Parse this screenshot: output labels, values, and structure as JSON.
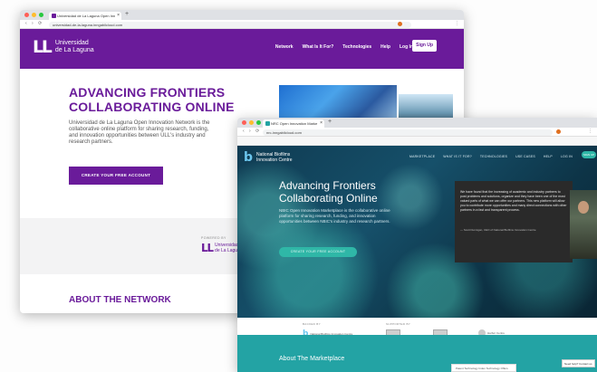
{
  "back_window": {
    "tab_title": "Universidad de La Laguna Open Inn",
    "url": "universidad-de-la-laguna.inngabilcloud.com",
    "nav": {
      "logo_line1": "Universidad",
      "logo_line2": "de La Laguna",
      "menu": [
        "Network",
        "What Is It For?",
        "Technologies",
        "Help",
        "Log In"
      ],
      "signup": "Sign Up"
    },
    "hero": {
      "title_line1": "ADVANCING FRONTIERS",
      "title_line2": "COLLABORATING ONLINE",
      "body": "Universidad de La Laguna Open Innovation Network is the collaborative online platform for sharing research, funding, and innovation opportunities between ULL's industry and research partners.",
      "cta": "CREATE YOUR FREE ACCOUNT"
    },
    "powered_by": "POWERED BY",
    "footer_logo_line1": "Universidad",
    "footer_logo_line2": "de La Laguna",
    "about": "ABOUT THE NETWORK"
  },
  "front_window": {
    "tab_title": "NRC Open Innovation Marke",
    "url": "nrc-inngabilcloud.com",
    "nav": {
      "logo_line1": "National Biofilms",
      "logo_line2": "Innovation Centre",
      "menu": [
        "MARKETPLACE",
        "WHAT IS IT FOR?",
        "TECHNOLOGIES",
        "USE CASES",
        "HELP",
        "LOG IN"
      ],
      "signup": "SIGN UP"
    },
    "hero": {
      "title_line1": "Advancing Frontiers",
      "title_line2": "Collaborating Online",
      "body": "NBIC Open Innovation Marketplace is the collaborative online platform for sharing research, funding, and innovation opportunities between NBIC's industry and research partners.",
      "cta": "CREATE YOUR FREE ACCOUNT"
    },
    "video": {
      "quote": "We have found that the increasing of academic and industry partners to post problems and solutions, organize and they have been one of the most valued parts of what we can offer our partners. This new platform will allow you to contribute more opportunities and many direct connections with other partners in a fast and transparent process.",
      "caption": "— Scott Dunnigan, CEO of National Biofilms Innovation Centre"
    },
    "partners": {
      "backed_by": "BACKED BY",
      "backed_logo": "National Biofilms Innovation Centre",
      "supported_by": "SUPPORTED BY",
      "supporter_name": "Harbor Centre"
    },
    "about": "About The Marketplace",
    "toast": "Patent Technology Index Technology Offers",
    "chat": "Need help? Contact us"
  },
  "colors": {
    "ull_purple": "#6a1b9a",
    "nrc_teal": "#23a3a4",
    "nrc_dark": "#0f3b52"
  }
}
